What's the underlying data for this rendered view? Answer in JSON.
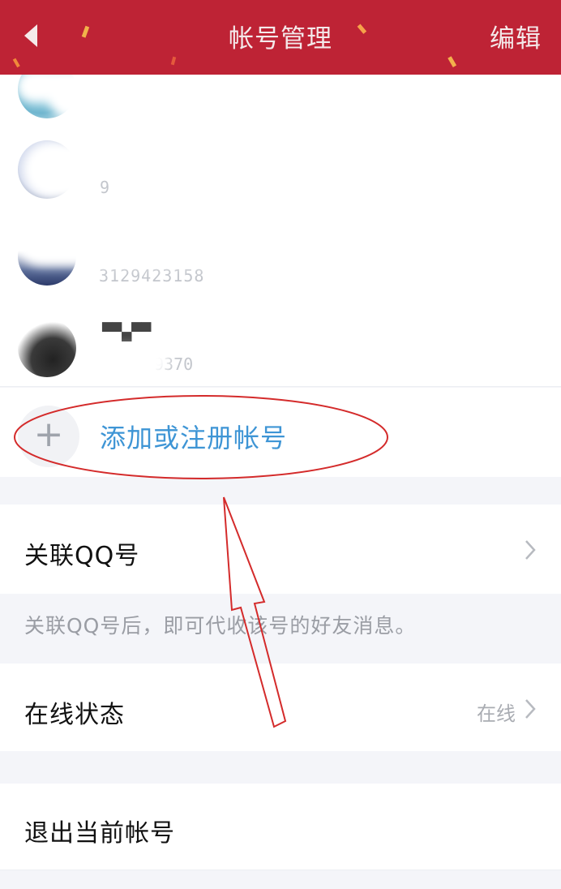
{
  "header": {
    "title": "帐号管理",
    "edit_label": "编辑",
    "background_color": "#be2335"
  },
  "accounts": [
    {
      "name": "",
      "number": ""
    },
    {
      "name": "",
      "number": "9"
    },
    {
      "name": "",
      "number": "3129423158"
    },
    {
      "name": "",
      "number": "9370"
    }
  ],
  "add_account": {
    "icon": "plus-icon",
    "label": "添加或注册帐号",
    "label_color": "#3e95d5"
  },
  "link_qq": {
    "label": "关联QQ号",
    "tip": "关联QQ号后，即可代收该号的好友消息。"
  },
  "online_status": {
    "label": "在线状态",
    "value": "在线"
  },
  "logout": {
    "label": "退出当前帐号"
  },
  "annotation": {
    "color": "#d42b2b",
    "shapes": [
      "ellipse",
      "arrow"
    ]
  }
}
